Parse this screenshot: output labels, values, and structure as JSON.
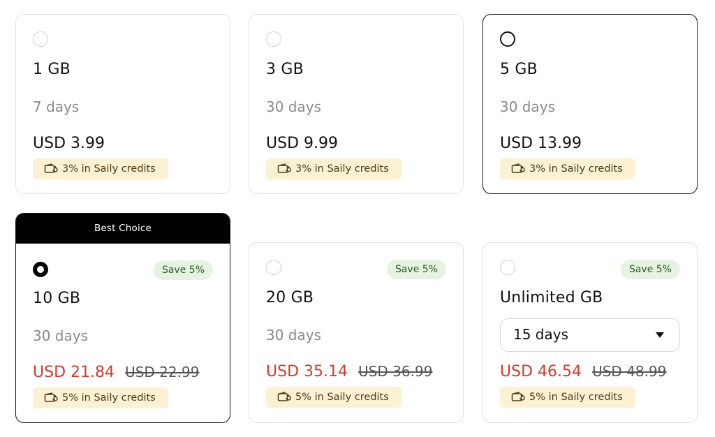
{
  "plans": [
    {
      "gb": "1 GB",
      "days": "7 days",
      "price": "USD 3.99",
      "credits": "3% in Saily credits"
    },
    {
      "gb": "3 GB",
      "days": "30 days",
      "price": "USD 9.99",
      "credits": "3% in Saily credits"
    },
    {
      "gb": "5 GB",
      "days": "30 days",
      "price": "USD 13.99",
      "credits": "3% in Saily credits"
    },
    {
      "banner": "Best Choice",
      "save": "Save 5%",
      "gb": "10 GB",
      "days": "30 days",
      "price": "USD 21.84",
      "old_price": "USD 22.99",
      "credits": "5% in Saily credits"
    },
    {
      "save": "Save 5%",
      "gb": "20 GB",
      "days": "30 days",
      "price": "USD 35.14",
      "old_price": "USD 36.99",
      "credits": "5% in Saily credits"
    },
    {
      "save": "Save 5%",
      "gb": "Unlimited GB",
      "days_select": "15 days",
      "price": "USD 46.54",
      "old_price": "USD 48.99",
      "credits": "5% in Saily credits"
    }
  ],
  "colors": {
    "discount_price": "#d23b2b",
    "save_badge_bg": "#e6f3e3",
    "save_badge_text": "#2d5a24",
    "credits_bg": "#fdf1d3",
    "banner_bg": "#000000"
  },
  "icons": {
    "credits": "wallet-refresh-icon",
    "dropdown": "caret-down-icon"
  }
}
